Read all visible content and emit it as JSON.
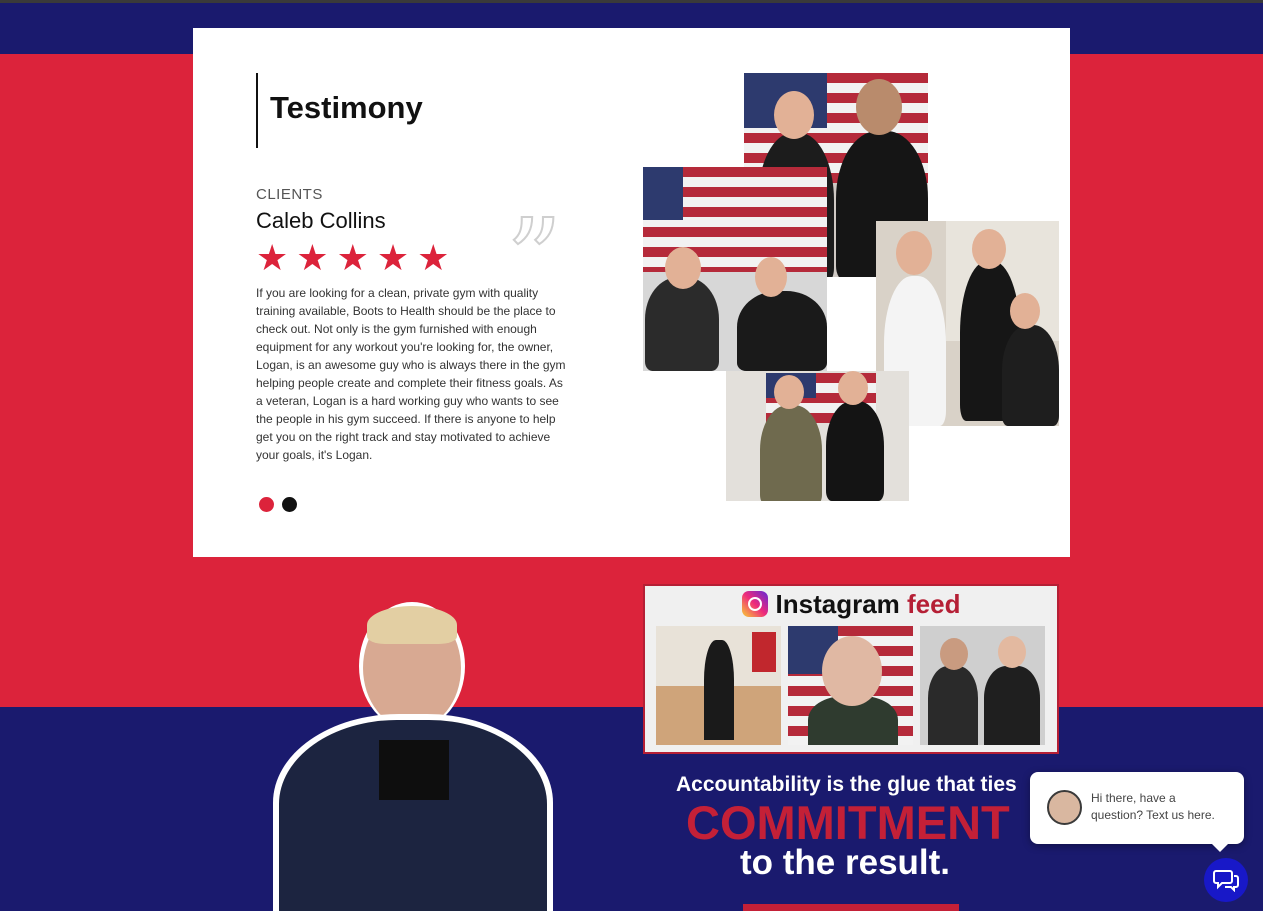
{
  "testimonial": {
    "heading": "Testimony",
    "category": "CLIENTS",
    "client_name": "Caleb Collins",
    "rating": 5,
    "quote_mark": "”",
    "text": "If you are looking for a clean, private gym with quality training available, Boots to Health should be the place to check out. Not only is the gym furnished with enough equipment for any workout you're looking for, the owner, Logan, is an awesome guy who is always there in the gym helping people create and complete their fitness goals. As a veteran, Logan is a hard working guy who wants to see the people in his gym succeed. If there is anyone to help get you on the right track and stay motivated to achieve your goals, it's Logan.",
    "slide_count": 2,
    "active_slide": 1
  },
  "instagram": {
    "title_main": "Instagram",
    "title_accent": "feed",
    "icon": "instagram-icon"
  },
  "motto": {
    "line1": "Accountability is the glue that ties",
    "line2": "COMMITMENT",
    "line3": "to the result."
  },
  "chat": {
    "message": "Hi there, have a question? Text us here.",
    "icon": "chat-bubbles-icon"
  },
  "colors": {
    "brand_red": "#dc233b",
    "brand_navy": "#1a1a6e",
    "chat_blue": "#1818c8"
  }
}
